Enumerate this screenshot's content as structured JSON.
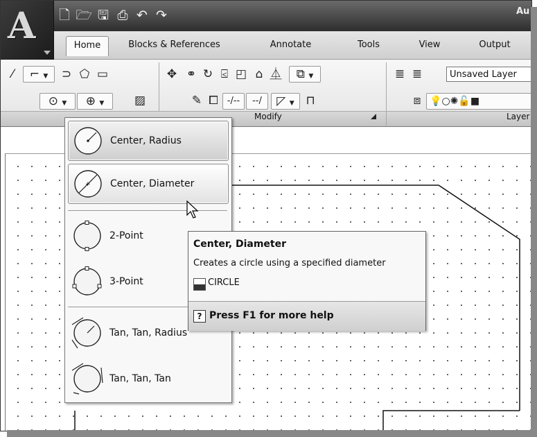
{
  "app": {
    "title": "Au"
  },
  "quick_access": [
    "new-icon",
    "open-icon",
    "save-icon",
    "print-icon",
    "undo-icon",
    "redo-icon"
  ],
  "tabs": [
    {
      "label": "Home",
      "active": true
    },
    {
      "label": "Blocks & References"
    },
    {
      "label": "Annotate"
    },
    {
      "label": "Tools"
    },
    {
      "label": "View"
    },
    {
      "label": "Output"
    }
  ],
  "ribbon": {
    "panel_modify": "Modify",
    "panel_layer": "Layer",
    "layer_current": "Unsaved Layer"
  },
  "circle_menu": {
    "items": [
      {
        "label": "Center, Radius",
        "icon": "circle-center-radius-icon"
      },
      {
        "label": "Center, Diameter",
        "icon": "circle-center-diameter-icon"
      },
      {
        "label": "2-Point",
        "icon": "circle-2-point-icon"
      },
      {
        "label": "3-Point",
        "icon": "circle-3-point-icon"
      },
      {
        "label": "Tan, Tan, Radius",
        "icon": "circle-tan-tan-radius-icon"
      },
      {
        "label": "Tan, Tan, Tan",
        "icon": "circle-tan-tan-tan-icon"
      }
    ]
  },
  "tooltip": {
    "title": "Center, Diameter",
    "description": "Creates a circle using a specified diameter",
    "command": "CIRCLE",
    "help": "Press F1 for more help",
    "help_key": "?"
  },
  "colors": {
    "titlebar": "#3a3a3a",
    "ribbon": "#ececec",
    "highlight": "#d4d4d4"
  }
}
